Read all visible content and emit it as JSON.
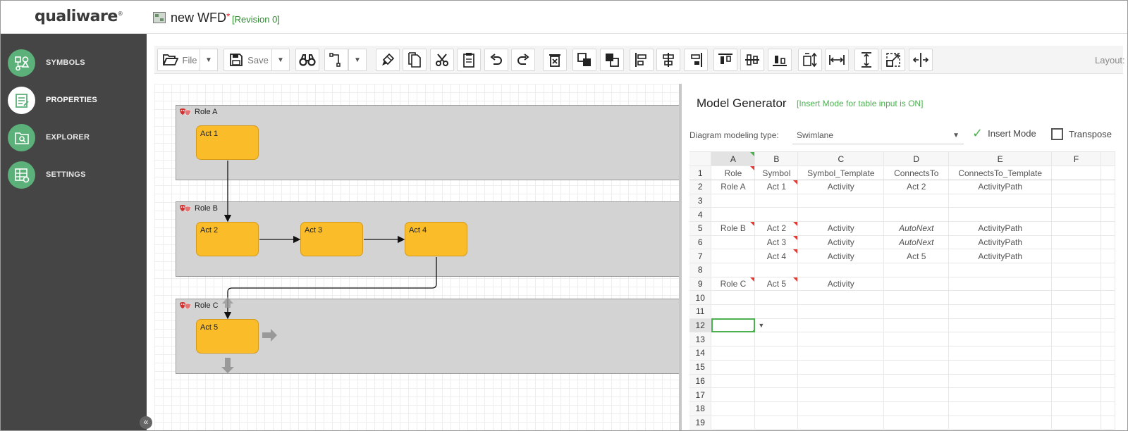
{
  "app": {
    "logo": "qualiware",
    "logo_mark": "®",
    "doc_title": "new WFD",
    "doc_modified_marker": "*",
    "revision": "[Revision 0]"
  },
  "sidebar": {
    "items": [
      {
        "label": "SYMBOLS",
        "icon": "symbols-icon"
      },
      {
        "label": "PROPERTIES",
        "icon": "properties-icon",
        "active": true
      },
      {
        "label": "EXPLORER",
        "icon": "explorer-icon"
      },
      {
        "label": "SETTINGS",
        "icon": "settings-icon"
      }
    ],
    "collapse": "«"
  },
  "toolbar": {
    "file_label": "File",
    "save_label": "Save",
    "layout_label": "Layout:",
    "layout_value": "",
    "more": "⋮",
    "icons": [
      "open-folder-icon",
      "save-icon",
      "find-icon",
      "connector-icon",
      "format-painter-icon",
      "copy-icon",
      "cut-icon",
      "paste-icon",
      "undo-icon",
      "redo-icon",
      "delete-icon",
      "bring-forward-icon",
      "send-backward-icon",
      "align-left-icon",
      "align-center-icon",
      "align-right-icon",
      "align-top-icon",
      "align-middle-icon",
      "align-bottom-icon",
      "same-height-icon",
      "same-width-icon",
      "same-size-vertical-icon",
      "resize-icon",
      "distribute-icon"
    ]
  },
  "diagram": {
    "lanes": [
      {
        "name": "Role A",
        "activities": [
          "Act 1"
        ]
      },
      {
        "name": "Role B",
        "activities": [
          "Act 2",
          "Act 3",
          "Act 4"
        ]
      },
      {
        "name": "Role C",
        "activities": [
          "Act 5"
        ]
      }
    ],
    "colors": {
      "activity": "#fbbc2a",
      "lane": "#d3d3d3",
      "accent": "#5cb079"
    }
  },
  "model_generator": {
    "title": "Model Generator",
    "insert_notice": "[Insert Mode for table input is ON]",
    "dml_label": "Diagram modeling type:",
    "dml_value": "Swimlane",
    "insert_mode_label": "Insert Mode",
    "insert_mode_checked": true,
    "transpose_label": "Transpose",
    "transpose_checked": false,
    "columns": [
      "A",
      "B",
      "C",
      "D",
      "E",
      "F"
    ],
    "rows": [
      {
        "n": "1",
        "cells": [
          "Role",
          "Symbol",
          "Symbol_Template",
          "ConnectsTo",
          "ConnectsTo_Template",
          ""
        ]
      },
      {
        "n": "2",
        "cells": [
          "Role A",
          "Act 1",
          "Activity",
          "Act 2",
          "ActivityPath",
          ""
        ]
      },
      {
        "n": "3",
        "cells": [
          "",
          "",
          "",
          "",
          "",
          ""
        ]
      },
      {
        "n": "4",
        "cells": [
          "",
          "",
          "",
          "",
          "",
          ""
        ]
      },
      {
        "n": "5",
        "cells": [
          "Role B",
          "Act 2",
          "Activity",
          "AutoNext",
          "ActivityPath",
          ""
        ]
      },
      {
        "n": "6",
        "cells": [
          "",
          "Act 3",
          "Activity",
          "AutoNext",
          "ActivityPath",
          ""
        ]
      },
      {
        "n": "7",
        "cells": [
          "",
          "Act 4",
          "Activity",
          "Act 5",
          "ActivityPath",
          ""
        ]
      },
      {
        "n": "8",
        "cells": [
          "",
          "",
          "",
          "",
          "",
          ""
        ]
      },
      {
        "n": "9",
        "cells": [
          "Role C",
          "Act 5",
          "Activity",
          "",
          "",
          ""
        ]
      },
      {
        "n": "10",
        "cells": [
          "",
          "",
          "",
          "",
          "",
          ""
        ]
      },
      {
        "n": "11",
        "cells": [
          "",
          "",
          "",
          "",
          "",
          ""
        ]
      },
      {
        "n": "12",
        "cells": [
          "",
          "▼",
          "",
          "",
          "",
          ""
        ]
      },
      {
        "n": "13",
        "cells": [
          "",
          "",
          "",
          "",
          "",
          ""
        ]
      },
      {
        "n": "14",
        "cells": [
          "",
          "",
          "",
          "",
          "",
          ""
        ]
      },
      {
        "n": "15",
        "cells": [
          "",
          "",
          "",
          "",
          "",
          ""
        ]
      },
      {
        "n": "16",
        "cells": [
          "",
          "",
          "",
          "",
          "",
          ""
        ]
      },
      {
        "n": "17",
        "cells": [
          "",
          "",
          "",
          "",
          "",
          ""
        ]
      },
      {
        "n": "18",
        "cells": [
          "",
          "",
          "",
          "",
          "",
          ""
        ]
      },
      {
        "n": "19",
        "cells": [
          "",
          "",
          "",
          "",
          "",
          ""
        ]
      }
    ],
    "colors": {
      "notice": "#4caf50",
      "note_marker": "#e53935"
    }
  }
}
